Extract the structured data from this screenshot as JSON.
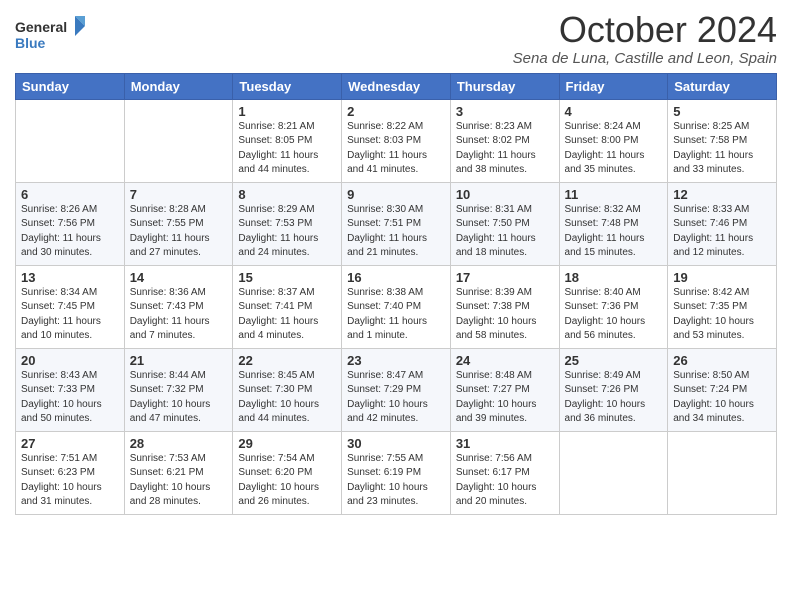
{
  "header": {
    "logo_line1": "General",
    "logo_line2": "Blue",
    "title": "October 2024",
    "subtitle": "Sena de Luna, Castille and Leon, Spain"
  },
  "weekdays": [
    "Sunday",
    "Monday",
    "Tuesday",
    "Wednesday",
    "Thursday",
    "Friday",
    "Saturday"
  ],
  "weeks": [
    [
      {
        "day": "",
        "info": ""
      },
      {
        "day": "",
        "info": ""
      },
      {
        "day": "1",
        "info": "Sunrise: 8:21 AM\nSunset: 8:05 PM\nDaylight: 11 hours and 44 minutes."
      },
      {
        "day": "2",
        "info": "Sunrise: 8:22 AM\nSunset: 8:03 PM\nDaylight: 11 hours and 41 minutes."
      },
      {
        "day": "3",
        "info": "Sunrise: 8:23 AM\nSunset: 8:02 PM\nDaylight: 11 hours and 38 minutes."
      },
      {
        "day": "4",
        "info": "Sunrise: 8:24 AM\nSunset: 8:00 PM\nDaylight: 11 hours and 35 minutes."
      },
      {
        "day": "5",
        "info": "Sunrise: 8:25 AM\nSunset: 7:58 PM\nDaylight: 11 hours and 33 minutes."
      }
    ],
    [
      {
        "day": "6",
        "info": "Sunrise: 8:26 AM\nSunset: 7:56 PM\nDaylight: 11 hours and 30 minutes."
      },
      {
        "day": "7",
        "info": "Sunrise: 8:28 AM\nSunset: 7:55 PM\nDaylight: 11 hours and 27 minutes."
      },
      {
        "day": "8",
        "info": "Sunrise: 8:29 AM\nSunset: 7:53 PM\nDaylight: 11 hours and 24 minutes."
      },
      {
        "day": "9",
        "info": "Sunrise: 8:30 AM\nSunset: 7:51 PM\nDaylight: 11 hours and 21 minutes."
      },
      {
        "day": "10",
        "info": "Sunrise: 8:31 AM\nSunset: 7:50 PM\nDaylight: 11 hours and 18 minutes."
      },
      {
        "day": "11",
        "info": "Sunrise: 8:32 AM\nSunset: 7:48 PM\nDaylight: 11 hours and 15 minutes."
      },
      {
        "day": "12",
        "info": "Sunrise: 8:33 AM\nSunset: 7:46 PM\nDaylight: 11 hours and 12 minutes."
      }
    ],
    [
      {
        "day": "13",
        "info": "Sunrise: 8:34 AM\nSunset: 7:45 PM\nDaylight: 11 hours and 10 minutes."
      },
      {
        "day": "14",
        "info": "Sunrise: 8:36 AM\nSunset: 7:43 PM\nDaylight: 11 hours and 7 minutes."
      },
      {
        "day": "15",
        "info": "Sunrise: 8:37 AM\nSunset: 7:41 PM\nDaylight: 11 hours and 4 minutes."
      },
      {
        "day": "16",
        "info": "Sunrise: 8:38 AM\nSunset: 7:40 PM\nDaylight: 11 hours and 1 minute."
      },
      {
        "day": "17",
        "info": "Sunrise: 8:39 AM\nSunset: 7:38 PM\nDaylight: 10 hours and 58 minutes."
      },
      {
        "day": "18",
        "info": "Sunrise: 8:40 AM\nSunset: 7:36 PM\nDaylight: 10 hours and 56 minutes."
      },
      {
        "day": "19",
        "info": "Sunrise: 8:42 AM\nSunset: 7:35 PM\nDaylight: 10 hours and 53 minutes."
      }
    ],
    [
      {
        "day": "20",
        "info": "Sunrise: 8:43 AM\nSunset: 7:33 PM\nDaylight: 10 hours and 50 minutes."
      },
      {
        "day": "21",
        "info": "Sunrise: 8:44 AM\nSunset: 7:32 PM\nDaylight: 10 hours and 47 minutes."
      },
      {
        "day": "22",
        "info": "Sunrise: 8:45 AM\nSunset: 7:30 PM\nDaylight: 10 hours and 44 minutes."
      },
      {
        "day": "23",
        "info": "Sunrise: 8:47 AM\nSunset: 7:29 PM\nDaylight: 10 hours and 42 minutes."
      },
      {
        "day": "24",
        "info": "Sunrise: 8:48 AM\nSunset: 7:27 PM\nDaylight: 10 hours and 39 minutes."
      },
      {
        "day": "25",
        "info": "Sunrise: 8:49 AM\nSunset: 7:26 PM\nDaylight: 10 hours and 36 minutes."
      },
      {
        "day": "26",
        "info": "Sunrise: 8:50 AM\nSunset: 7:24 PM\nDaylight: 10 hours and 34 minutes."
      }
    ],
    [
      {
        "day": "27",
        "info": "Sunrise: 7:51 AM\nSunset: 6:23 PM\nDaylight: 10 hours and 31 minutes."
      },
      {
        "day": "28",
        "info": "Sunrise: 7:53 AM\nSunset: 6:21 PM\nDaylight: 10 hours and 28 minutes."
      },
      {
        "day": "29",
        "info": "Sunrise: 7:54 AM\nSunset: 6:20 PM\nDaylight: 10 hours and 26 minutes."
      },
      {
        "day": "30",
        "info": "Sunrise: 7:55 AM\nSunset: 6:19 PM\nDaylight: 10 hours and 23 minutes."
      },
      {
        "day": "31",
        "info": "Sunrise: 7:56 AM\nSunset: 6:17 PM\nDaylight: 10 hours and 20 minutes."
      },
      {
        "day": "",
        "info": ""
      },
      {
        "day": "",
        "info": ""
      }
    ]
  ]
}
